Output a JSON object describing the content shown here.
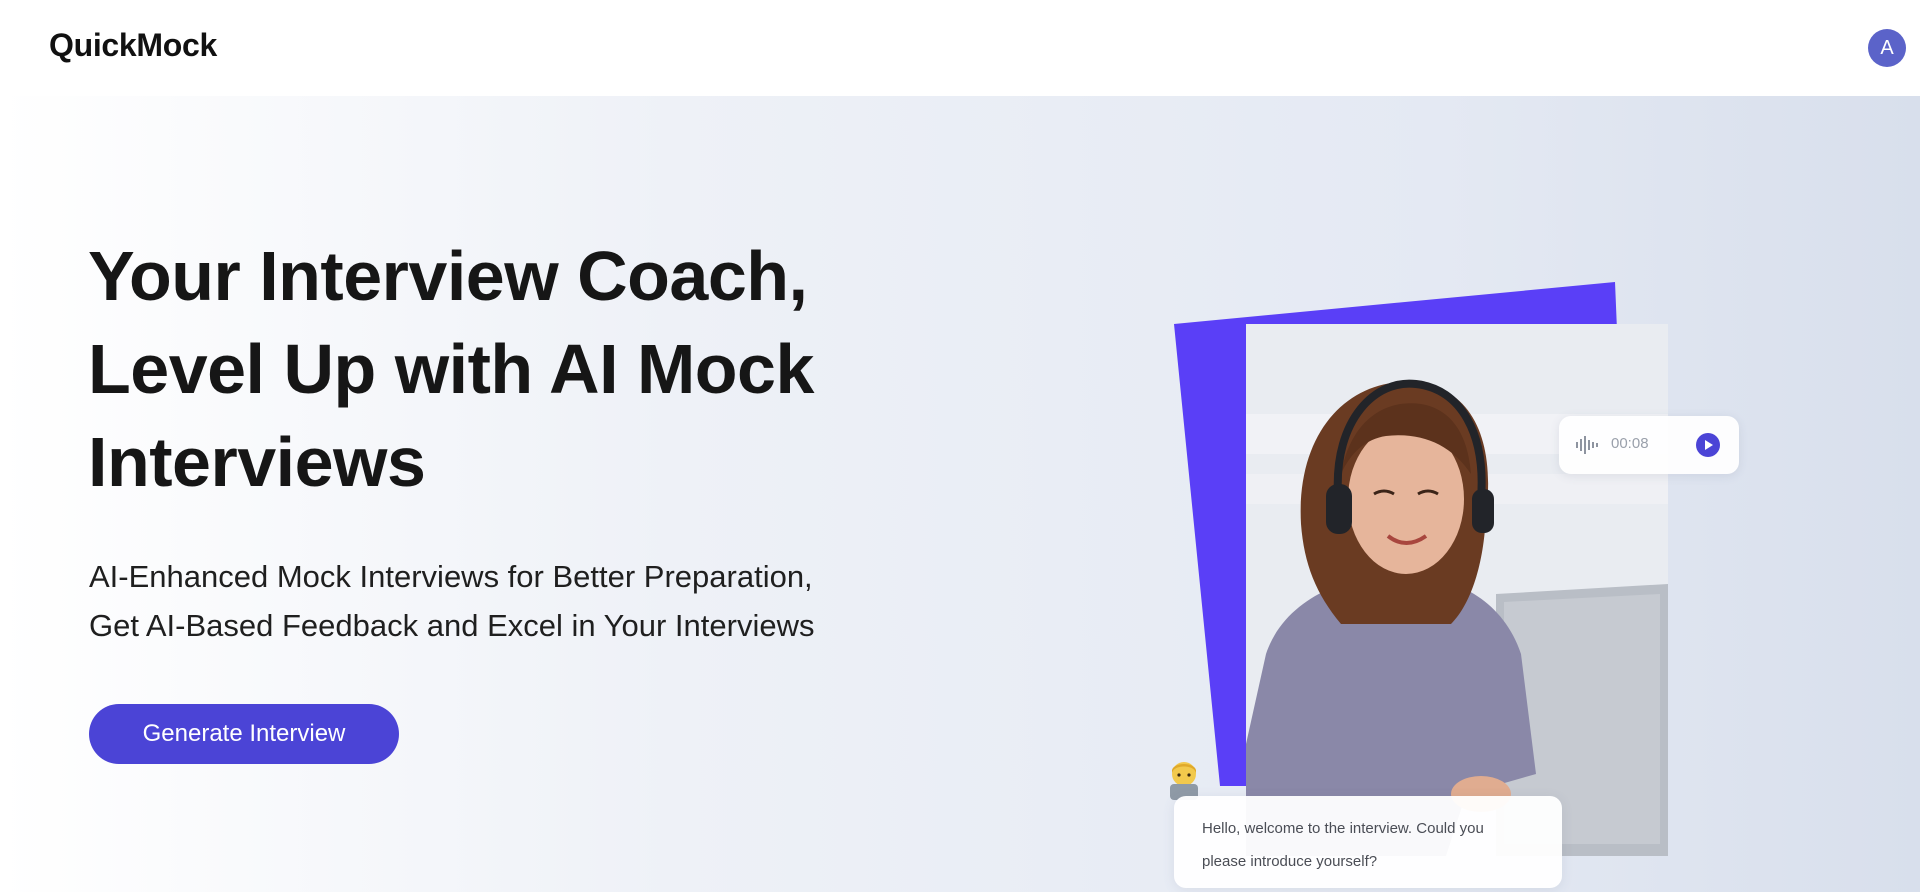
{
  "navbar": {
    "brand": "QuickMock",
    "avatar_initial": "A"
  },
  "hero": {
    "headline_lines": [
      "Your Interview Coach,",
      "Level Up with AI Mock",
      "Interviews"
    ],
    "subtitle_lines": [
      "AI-Enhanced Mock Interviews for Better Preparation,",
      "Get AI-Based Feedback and Excel in Your Interviews"
    ],
    "cta_label": "Generate Interview"
  },
  "illustration": {
    "audio_time": "00:08",
    "chat_lines": [
      "Hello, welcome to the interview. Could you",
      "please introduce yourself?"
    ],
    "accent_color": "#5a3ff7",
    "icons": [
      "waveform-icon",
      "play-icon",
      "bot-avatar-icon"
    ]
  },
  "colors": {
    "primary": "#4b44d6",
    "avatar": "#5b63c9",
    "text": "#161616"
  }
}
